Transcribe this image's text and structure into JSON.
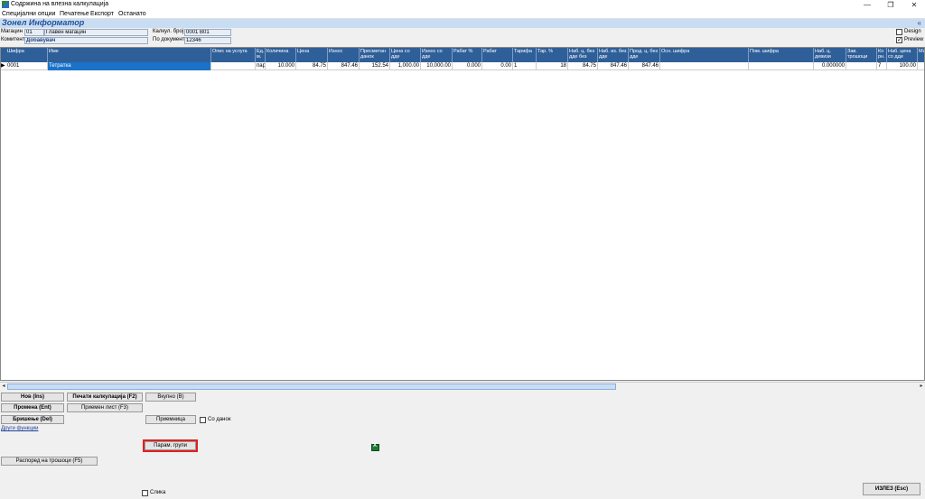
{
  "window": {
    "title": "Содржина на влезна калкулација",
    "controls": [
      "—",
      "❐",
      "✕"
    ]
  },
  "menu": [
    "Специјални опции",
    "Печатење",
    "Експорт",
    "Останато"
  ],
  "informer": {
    "title": "Зонел Информатор",
    "collapse": "«"
  },
  "header": {
    "magacin_label": "Магацин",
    "magacin_code": "01",
    "magacin_name": "Главен магацин",
    "komitent_label": "Комитент",
    "komitent_value": "Добавувач",
    "kalkul_label": "Калкул. број",
    "kalkul_value": "0001   В01",
    "dokument_label": "По документ",
    "dokument_value": "12346",
    "design_label": "Design",
    "preview_label": "Preview",
    "design_checked": false,
    "preview_checked": true
  },
  "grid": {
    "columns": [
      "Шифра",
      "Име",
      "Опис на услуга",
      "Ед. м.",
      "Количина",
      "Цена",
      "Износ",
      "Пресметан данок",
      "Цена со дде",
      "Износ со дде",
      "Рабат %",
      "Рабат",
      "Тарифа",
      "Тар. %",
      "Наб. ц. без дде без",
      "Наб. из. без дде",
      "Прод. ц. без дде",
      "Осн. шифра",
      "Пом. шифра",
      "Наб. ц. девизи",
      "Зав. трошоци",
      "Ко рн.",
      "Наб. цена со дде",
      "Ма"
    ],
    "rows": [
      {
        "indicator": "▶",
        "cells": [
          "0001",
          "Тетратка",
          "",
          "пар",
          "10.000",
          "84.75",
          "847.46",
          "152.54",
          "1,000.00",
          "10,000.00",
          "0.000",
          "0.00",
          "1",
          "18",
          "84.75",
          "847.46",
          "847.46",
          "",
          "",
          "0.000000",
          "",
          "7",
          "100.00",
          ""
        ]
      }
    ]
  },
  "scroll": {
    "left": "◂",
    "right": "▸"
  },
  "buttons": {
    "nov": "Нов (Ins)",
    "promena": "Промена (Ent)",
    "brisenje": "Бришење (Del)",
    "drugi": "Други функции",
    "pecati": "Печати калкулација (F2)",
    "priemen_list": "Приемен лист (F3)",
    "vkupno": "Вкупно (В)",
    "priemnica": "Приемница",
    "so_danok": "Со данок",
    "param": "Парам. групи",
    "raspored": "Распоред на трошоци (F5)",
    "slika": "Слика",
    "izlez": "ИЗЛЕЗ (Esc)"
  }
}
